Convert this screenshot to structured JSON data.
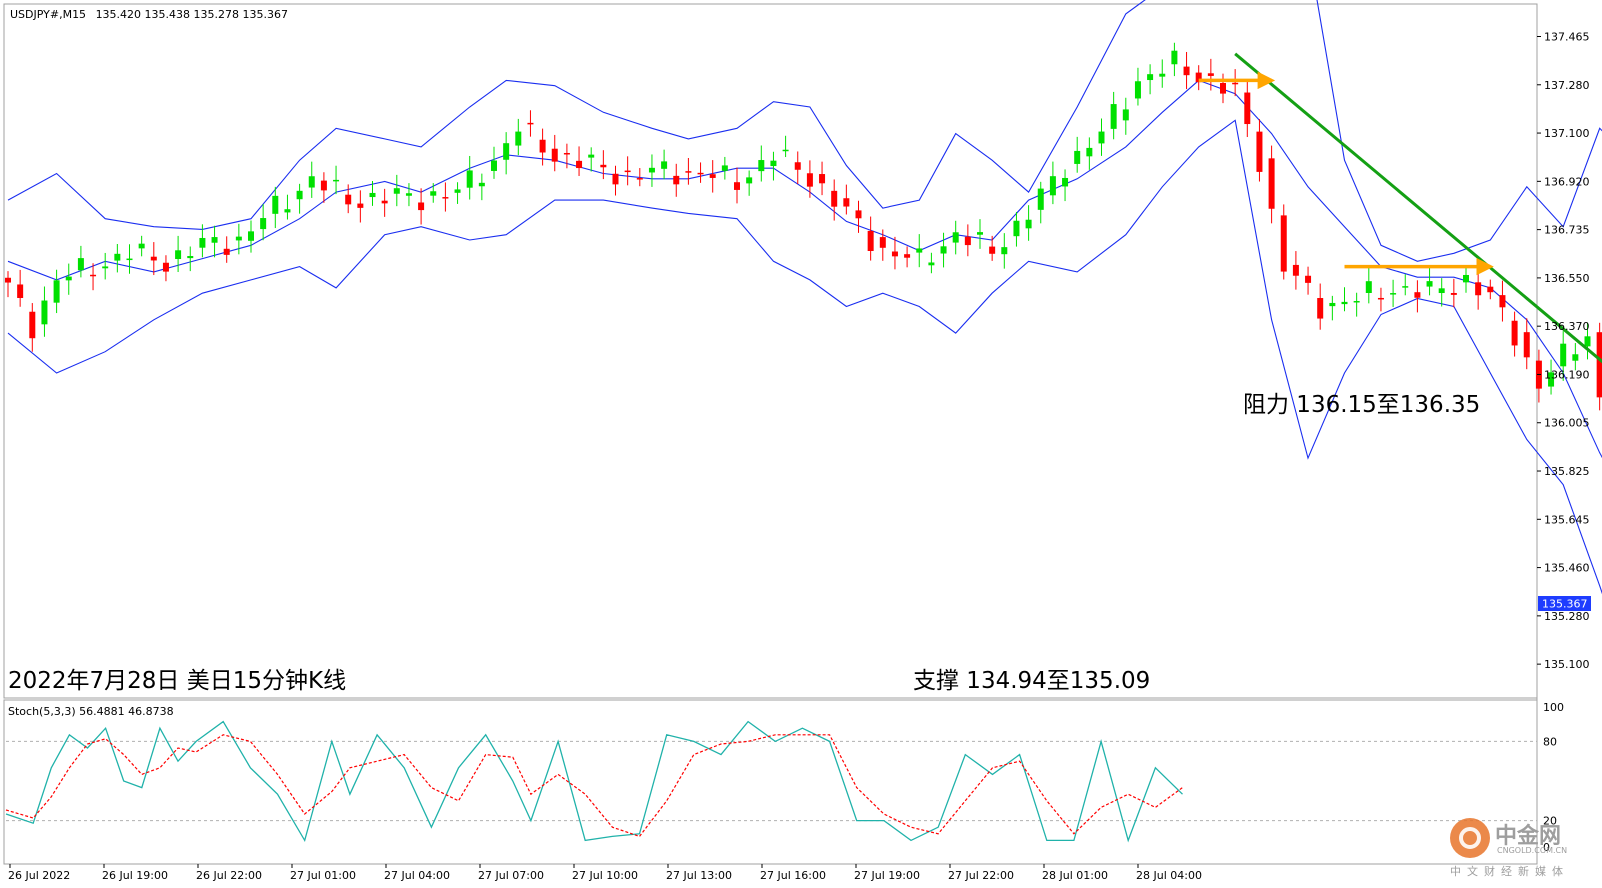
{
  "header": {
    "symbol": "USDJPY#,M15",
    "ohlc": "135.420 135.438 135.278 135.367"
  },
  "colors": {
    "bull": "#00e000",
    "bear": "#ff0000",
    "band": "#1a2ef0",
    "trend": "#14a014",
    "level_arrow": "#ffa500",
    "stoch_main": "#20b2aa",
    "stoch_signal": "#ff0000",
    "price_box": "#1e3cff"
  },
  "annotations": {
    "title": "2022年7月28日 美日15分钟K线",
    "resistance": "阻力 136.15至136.35",
    "support": "支撑 134.94至135.09"
  },
  "stoch": {
    "label": "Stoch(5,3,3) 56.4881 46.8738",
    "levels": [
      "100",
      "80",
      "20",
      "0"
    ]
  },
  "watermark": {
    "name": "中金网",
    "domain": "CNGOLD.COM.CN",
    "tagline": "中文财经新媒体"
  },
  "chart_data": {
    "type": "candlestick",
    "interval": "M15",
    "current_price": "135.367",
    "y_ticks": [
      "137.465",
      "137.280",
      "137.100",
      "136.920",
      "136.735",
      "136.550",
      "136.370",
      "136.190",
      "136.005",
      "135.825",
      "135.645",
      "135.460",
      "135.280",
      "135.100"
    ],
    "x_ticks": [
      "26 Jul 2022",
      "26 Jul 19:00",
      "26 Jul 22:00",
      "27 Jul 01:00",
      "27 Jul 04:00",
      "27 Jul 07:00",
      "27 Jul 10:00",
      "27 Jul 13:00",
      "27 Jul 16:00",
      "27 Jul 19:00",
      "27 Jul 22:00",
      "28 Jul 01:00",
      "28 Jul 04:00"
    ],
    "close_path": [
      [
        0,
        136.52
      ],
      [
        2,
        136.38
      ],
      [
        4,
        136.55
      ],
      [
        7,
        136.6
      ],
      [
        10,
        136.65
      ],
      [
        13,
        136.62
      ],
      [
        16,
        136.68
      ],
      [
        19,
        136.7
      ],
      [
        22,
        136.82
      ],
      [
        25,
        136.93
      ],
      [
        28,
        136.85
      ],
      [
        31,
        136.86
      ],
      [
        34,
        136.86
      ],
      [
        37,
        136.88
      ],
      [
        40,
        137.0
      ],
      [
        42,
        137.12
      ],
      [
        45,
        137.02
      ],
      [
        48,
        136.98
      ],
      [
        51,
        136.94
      ],
      [
        54,
        136.96
      ],
      [
        57,
        136.95
      ],
      [
        60,
        136.92
      ],
      [
        63,
        137.02
      ],
      [
        66,
        136.94
      ],
      [
        69,
        136.8
      ],
      [
        72,
        136.66
      ],
      [
        75,
        136.62
      ],
      [
        78,
        136.72
      ],
      [
        81,
        136.66
      ],
      [
        84,
        136.8
      ],
      [
        87,
        136.98
      ],
      [
        90,
        137.1
      ],
      [
        93,
        137.3
      ],
      [
        96,
        137.36
      ],
      [
        99,
        137.3
      ],
      [
        101,
        137.25
      ],
      [
        103,
        137.0
      ],
      [
        105,
        136.6
      ],
      [
        108,
        136.45
      ],
      [
        111,
        136.48
      ],
      [
        114,
        136.52
      ],
      [
        117,
        136.5
      ],
      [
        120,
        136.55
      ],
      [
        122,
        136.48
      ],
      [
        124,
        136.35
      ],
      [
        126,
        136.15
      ],
      [
        128,
        136.26
      ],
      [
        130,
        136.35
      ],
      [
        132,
        135.85
      ],
      [
        134,
        135.35
      ],
      [
        136,
        135.45
      ],
      [
        138,
        135.4
      ],
      [
        139,
        135.37
      ]
    ],
    "bands": {
      "upper": [
        [
          0,
          136.85
        ],
        [
          4,
          136.95
        ],
        [
          8,
          136.78
        ],
        [
          12,
          136.75
        ],
        [
          16,
          136.74
        ],
        [
          20,
          136.78
        ],
        [
          24,
          137.0
        ],
        [
          27,
          137.12
        ],
        [
          31,
          137.08
        ],
        [
          34,
          137.05
        ],
        [
          38,
          137.2
        ],
        [
          41,
          137.3
        ],
        [
          45,
          137.28
        ],
        [
          49,
          137.18
        ],
        [
          53,
          137.12
        ],
        [
          56,
          137.08
        ],
        [
          60,
          137.12
        ],
        [
          63,
          137.22
        ],
        [
          66,
          137.2
        ],
        [
          69,
          136.98
        ],
        [
          72,
          136.82
        ],
        [
          75,
          136.85
        ],
        [
          78,
          137.1
        ],
        [
          81,
          137.0
        ],
        [
          84,
          136.88
        ],
        [
          88,
          137.2
        ],
        [
          92,
          137.55
        ],
        [
          95,
          137.65
        ],
        [
          98,
          137.62
        ],
        [
          101,
          137.75
        ],
        [
          104,
          137.9
        ],
        [
          107,
          137.8
        ],
        [
          110,
          137.0
        ],
        [
          113,
          136.68
        ],
        [
          116,
          136.62
        ],
        [
          119,
          136.65
        ],
        [
          122,
          136.7
        ],
        [
          125,
          136.9
        ],
        [
          128,
          136.75
        ],
        [
          131,
          137.12
        ],
        [
          134,
          136.98
        ],
        [
          136,
          136.65
        ]
      ],
      "middle": [
        [
          0,
          136.62
        ],
        [
          4,
          136.55
        ],
        [
          8,
          136.62
        ],
        [
          12,
          136.58
        ],
        [
          16,
          136.63
        ],
        [
          20,
          136.68
        ],
        [
          24,
          136.78
        ],
        [
          27,
          136.88
        ],
        [
          31,
          136.92
        ],
        [
          34,
          136.88
        ],
        [
          38,
          136.97
        ],
        [
          41,
          137.02
        ],
        [
          45,
          137.0
        ],
        [
          49,
          136.95
        ],
        [
          53,
          136.93
        ],
        [
          56,
          136.93
        ],
        [
          60,
          136.97
        ],
        [
          63,
          136.97
        ],
        [
          66,
          136.88
        ],
        [
          69,
          136.77
        ],
        [
          72,
          136.72
        ],
        [
          75,
          136.66
        ],
        [
          78,
          136.72
        ],
        [
          81,
          136.7
        ],
        [
          84,
          136.85
        ],
        [
          88,
          136.93
        ],
        [
          92,
          137.05
        ],
        [
          95,
          137.18
        ],
        [
          98,
          137.3
        ],
        [
          101,
          137.25
        ],
        [
          104,
          137.1
        ],
        [
          107,
          136.9
        ],
        [
          110,
          136.75
        ],
        [
          113,
          136.6
        ],
        [
          116,
          136.56
        ],
        [
          119,
          136.56
        ],
        [
          122,
          136.52
        ],
        [
          125,
          136.4
        ],
        [
          128,
          136.2
        ],
        [
          131,
          135.9
        ],
        [
          134,
          135.65
        ]
      ],
      "lower": [
        [
          0,
          136.35
        ],
        [
          4,
          136.2
        ],
        [
          8,
          136.28
        ],
        [
          12,
          136.4
        ],
        [
          16,
          136.5
        ],
        [
          20,
          136.55
        ],
        [
          24,
          136.6
        ],
        [
          27,
          136.52
        ],
        [
          31,
          136.72
        ],
        [
          34,
          136.75
        ],
        [
          38,
          136.7
        ],
        [
          41,
          136.72
        ],
        [
          45,
          136.85
        ],
        [
          49,
          136.85
        ],
        [
          53,
          136.82
        ],
        [
          56,
          136.8
        ],
        [
          60,
          136.78
        ],
        [
          63,
          136.62
        ],
        [
          66,
          136.55
        ],
        [
          69,
          136.45
        ],
        [
          72,
          136.5
        ],
        [
          75,
          136.45
        ],
        [
          78,
          136.35
        ],
        [
          81,
          136.5
        ],
        [
          84,
          136.62
        ],
        [
          88,
          136.58
        ],
        [
          92,
          136.72
        ],
        [
          95,
          136.9
        ],
        [
          98,
          137.05
        ],
        [
          101,
          137.15
        ],
        [
          104,
          136.4
        ],
        [
          107,
          135.88
        ],
        [
          110,
          136.2
        ],
        [
          113,
          136.42
        ],
        [
          116,
          136.48
        ],
        [
          119,
          136.45
        ],
        [
          122,
          136.2
        ],
        [
          125,
          135.95
        ],
        [
          128,
          135.78
        ],
        [
          131,
          135.4
        ],
        [
          134,
          135.0
        ]
      ]
    },
    "trendline": [
      [
        101,
        137.4
      ],
      [
        148,
        135.6
      ]
    ],
    "level_arrows": [
      {
        "from": [
          98,
          137.3
        ],
        "to": [
          104,
          137.3
        ]
      },
      {
        "from": [
          110,
          136.6
        ],
        "to": [
          122,
          136.6
        ]
      }
    ],
    "stoch_k": [
      [
        0,
        25
      ],
      [
        3,
        18
      ],
      [
        5,
        60
      ],
      [
        7,
        85
      ],
      [
        9,
        75
      ],
      [
        11,
        90
      ],
      [
        13,
        50
      ],
      [
        15,
        45
      ],
      [
        17,
        90
      ],
      [
        19,
        65
      ],
      [
        21,
        80
      ],
      [
        24,
        95
      ],
      [
        27,
        60
      ],
      [
        30,
        40
      ],
      [
        33,
        5
      ],
      [
        36,
        80
      ],
      [
        38,
        40
      ],
      [
        41,
        85
      ],
      [
        44,
        60
      ],
      [
        47,
        15
      ],
      [
        50,
        60
      ],
      [
        53,
        85
      ],
      [
        56,
        50
      ],
      [
        58,
        20
      ],
      [
        61,
        80
      ],
      [
        64,
        5
      ],
      [
        67,
        8
      ],
      [
        70,
        10
      ],
      [
        73,
        85
      ],
      [
        76,
        80
      ],
      [
        79,
        70
      ],
      [
        82,
        95
      ],
      [
        85,
        80
      ],
      [
        88,
        90
      ],
      [
        91,
        80
      ],
      [
        94,
        20
      ],
      [
        97,
        20
      ],
      [
        100,
        5
      ],
      [
        103,
        15
      ],
      [
        106,
        70
      ],
      [
        109,
        55
      ],
      [
        112,
        70
      ],
      [
        115,
        5
      ],
      [
        118,
        5
      ],
      [
        121,
        80
      ],
      [
        124,
        5
      ],
      [
        127,
        60
      ],
      [
        130,
        40
      ]
    ],
    "stoch_d": [
      [
        0,
        28
      ],
      [
        3,
        22
      ],
      [
        5,
        38
      ],
      [
        7,
        60
      ],
      [
        9,
        78
      ],
      [
        11,
        82
      ],
      [
        13,
        70
      ],
      [
        15,
        55
      ],
      [
        17,
        60
      ],
      [
        19,
        75
      ],
      [
        21,
        72
      ],
      [
        24,
        85
      ],
      [
        27,
        80
      ],
      [
        30,
        55
      ],
      [
        33,
        25
      ],
      [
        36,
        42
      ],
      [
        38,
        60
      ],
      [
        41,
        65
      ],
      [
        44,
        70
      ],
      [
        47,
        45
      ],
      [
        50,
        35
      ],
      [
        53,
        70
      ],
      [
        56,
        68
      ],
      [
        58,
        40
      ],
      [
        61,
        55
      ],
      [
        64,
        40
      ],
      [
        67,
        15
      ],
      [
        70,
        8
      ],
      [
        73,
        35
      ],
      [
        76,
        70
      ],
      [
        79,
        78
      ],
      [
        82,
        80
      ],
      [
        85,
        85
      ],
      [
        88,
        85
      ],
      [
        91,
        85
      ],
      [
        94,
        45
      ],
      [
        97,
        25
      ],
      [
        100,
        15
      ],
      [
        103,
        10
      ],
      [
        106,
        35
      ],
      [
        109,
        60
      ],
      [
        112,
        65
      ],
      [
        115,
        35
      ],
      [
        118,
        10
      ],
      [
        121,
        30
      ],
      [
        124,
        40
      ],
      [
        127,
        30
      ],
      [
        130,
        45
      ]
    ]
  }
}
